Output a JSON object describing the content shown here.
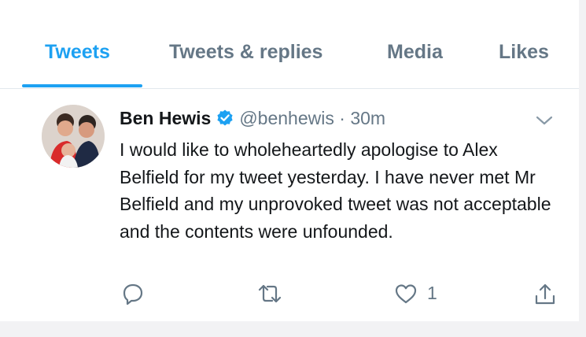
{
  "tabs": [
    {
      "label": "Tweets",
      "active": true
    },
    {
      "label": "Tweets & replies",
      "active": false
    },
    {
      "label": "Media",
      "active": false
    },
    {
      "label": "Likes",
      "active": false
    }
  ],
  "tweet": {
    "author_name": "Ben Hewis",
    "handle": "@benhewis",
    "separator": "·",
    "time": "30m",
    "text": "I would like to wholeheartedly apologise to Alex Belfield for my tweet yesterday. I have never met Mr Belfield and my unprovoked tweet was not acceptable and the contents were unfounded.",
    "like_count": "1",
    "icons": {
      "verified": "verified-badge-icon",
      "menu": "chevron-down-icon",
      "reply": "reply-icon",
      "retweet": "retweet-icon",
      "like": "heart-icon",
      "share": "share-icon"
    }
  },
  "colors": {
    "accent": "#1da1f2",
    "text": "#14171a",
    "muted": "#657786",
    "divider": "#e1e8ed"
  }
}
